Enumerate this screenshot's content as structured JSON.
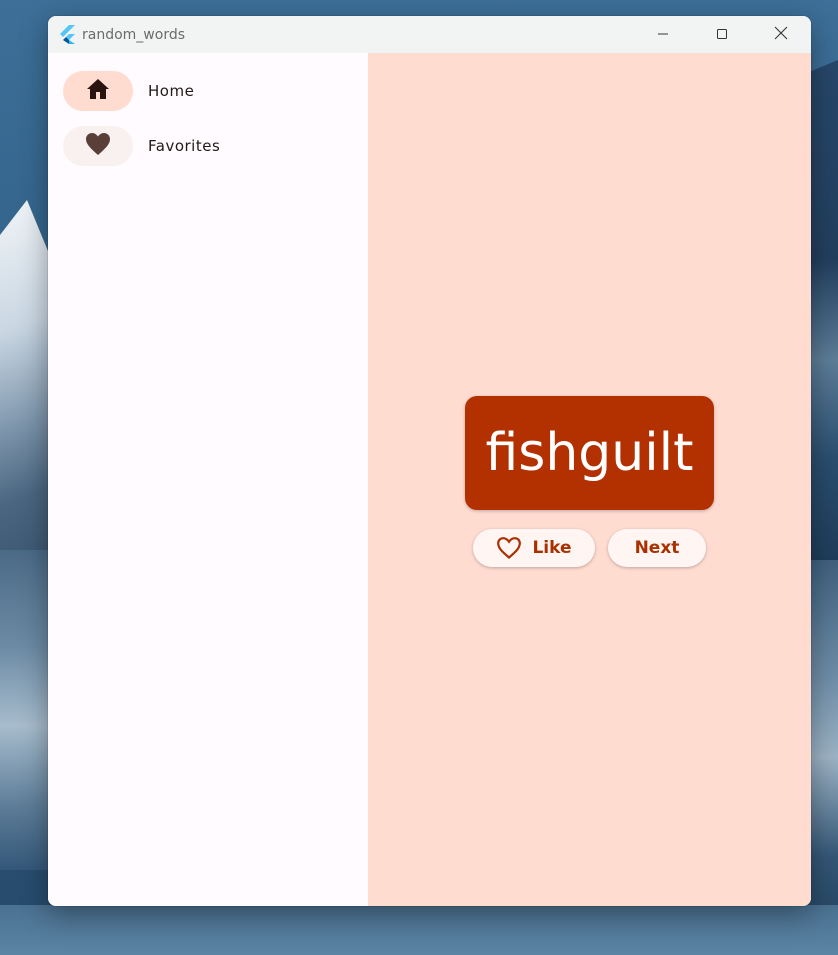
{
  "window": {
    "title": "random_words"
  },
  "sidebar": {
    "items": [
      {
        "label": "Home",
        "icon": "home-icon",
        "selected": true
      },
      {
        "label": "Favorites",
        "icon": "heart-icon",
        "selected": false
      }
    ]
  },
  "main": {
    "word": "fishguilt",
    "like_label": "Like",
    "next_label": "Next"
  },
  "colors": {
    "accent": "#b33000",
    "main_background": "#ffdbd0",
    "selected_pill": "#ffdbd0",
    "button_text": "#a93000"
  }
}
